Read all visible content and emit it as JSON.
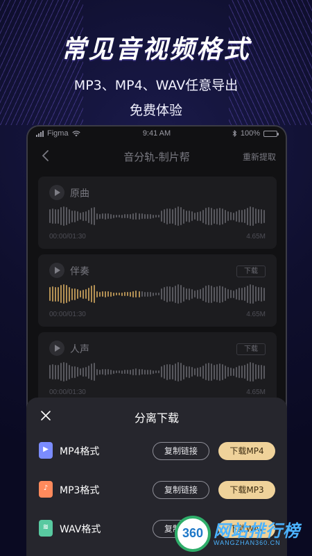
{
  "promo": {
    "title": "常见音视频格式",
    "subtitle_line1": "MP3、MP4、WAV任意导出",
    "subtitle_line2": "免费体验"
  },
  "status_bar": {
    "carrier": "Figma",
    "time": "9:41 AM",
    "battery": "100%"
  },
  "nav": {
    "title": "音分轨-制片帮",
    "action": "重新提取"
  },
  "tracks": [
    {
      "name": "原曲",
      "time": "00:00/01:30",
      "size": "4.65M",
      "download": "",
      "wave_color": "#8a8a92"
    },
    {
      "name": "伴奏",
      "time": "00:00/01:30",
      "size": "4.65M",
      "download": "下载",
      "wave_color": "#8a8a92",
      "progress_color": "#d9ae62"
    },
    {
      "name": "人声",
      "time": "00:00/01:30",
      "size": "4.65M",
      "download": "下载",
      "wave_color": "#8a8a92"
    }
  ],
  "sheet": {
    "title": "分离下载",
    "rows": [
      {
        "label": "MP4格式",
        "copy": "复制链接",
        "download": "下载MP4",
        "icon": "video-file-icon",
        "icon_color": "#7b8cff",
        "glyph": "▶"
      },
      {
        "label": "MP3格式",
        "copy": "复制链接",
        "download": "下载MP3",
        "icon": "audio-file-icon",
        "icon_color": "#ff8a5c",
        "glyph": "♪"
      },
      {
        "label": "WAV格式",
        "copy": "复制链接",
        "download": "下载WAV",
        "icon": "wav-file-icon",
        "icon_color": "#58c9a0",
        "glyph": "≋"
      }
    ]
  },
  "colors": {
    "accent_gold": "#efd29a",
    "background": "#0f0f2e",
    "card": "#1c1c1f",
    "sheet": "#26262d"
  },
  "watermark": {
    "logo_text": "360",
    "text": "网站排行榜",
    "subtext": "WANGZHAN360.CN"
  }
}
